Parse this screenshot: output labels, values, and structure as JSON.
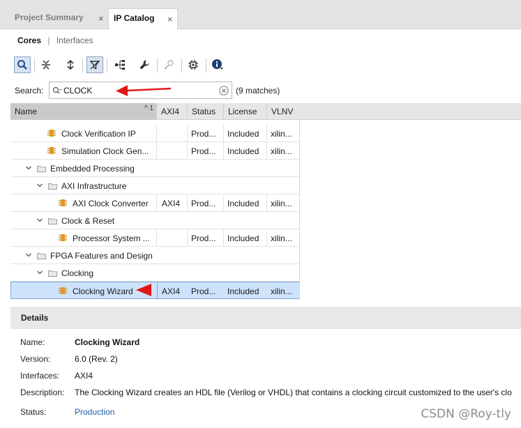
{
  "tabs": [
    {
      "label": "Project Summary",
      "active": false
    },
    {
      "label": "IP Catalog",
      "active": true
    }
  ],
  "tab_close_glyph": "×",
  "subnav": {
    "cores": "Cores",
    "separator": "|",
    "interfaces": "Interfaces"
  },
  "toolbar": {
    "icons": [
      "search-icon",
      "collapse-all-icon",
      "expand-all-icon",
      "filter-icon",
      "hierarchy-icon",
      "wrench-icon",
      "key-icon",
      "chip-icon",
      "info-icon"
    ]
  },
  "search": {
    "label": "Search:",
    "value": "CLOCK",
    "matches": "(9 matches)"
  },
  "table": {
    "columns": {
      "name": "Name",
      "sort_indicator": "^ 1",
      "axi4": "AXI4",
      "status": "Status",
      "license": "License",
      "vlnv": "VLNV"
    },
    "rows": [
      {
        "type": "ip",
        "name": "Clock Verification IP",
        "axi4": "",
        "status": "Prod...",
        "license": "Included",
        "vlnv": "xilin..."
      },
      {
        "type": "ip",
        "name": "Simulation Clock Gen...",
        "axi4": "",
        "status": "Prod...",
        "license": "Included",
        "vlnv": "xilin..."
      },
      {
        "type": "folder",
        "name": "Embedded Processing"
      },
      {
        "type": "folder",
        "name": "AXI Infrastructure"
      },
      {
        "type": "ip",
        "name": "AXI Clock Converter",
        "axi4": "AXI4",
        "status": "Prod...",
        "license": "Included",
        "vlnv": "xilin..."
      },
      {
        "type": "folder",
        "name": "Clock & Reset"
      },
      {
        "type": "ip",
        "name": "Processor System ...",
        "axi4": "",
        "status": "Prod...",
        "license": "Included",
        "vlnv": "xilin..."
      },
      {
        "type": "folder",
        "name": "FPGA Features and Design"
      },
      {
        "type": "folder",
        "name": "Clocking"
      },
      {
        "type": "ip",
        "name": "Clocking Wizard",
        "axi4": "AXI4",
        "status": "Prod...",
        "license": "Included",
        "vlnv": "xilin...",
        "selected": true
      }
    ]
  },
  "details": {
    "header": "Details",
    "name_label": "Name:",
    "name_value": "Clocking Wizard",
    "version_label": "Version:",
    "version_value": "6.0 (Rev. 2)",
    "interfaces_label": "Interfaces:",
    "interfaces_value": "AXI4",
    "description_label": "Description:",
    "description_value": "The Clocking Wizard creates an HDL file (Verilog or VHDL) that contains a clocking circuit customized to the user's clo",
    "status_label": "Status:",
    "status_value": "Production"
  },
  "watermark": "CSDN @Roy-tly",
  "colors": {
    "accent_arrow": "#e01818",
    "selection": "#cde2fb",
    "link": "#1f5ea8",
    "ip_icon": "#e39a1d"
  }
}
